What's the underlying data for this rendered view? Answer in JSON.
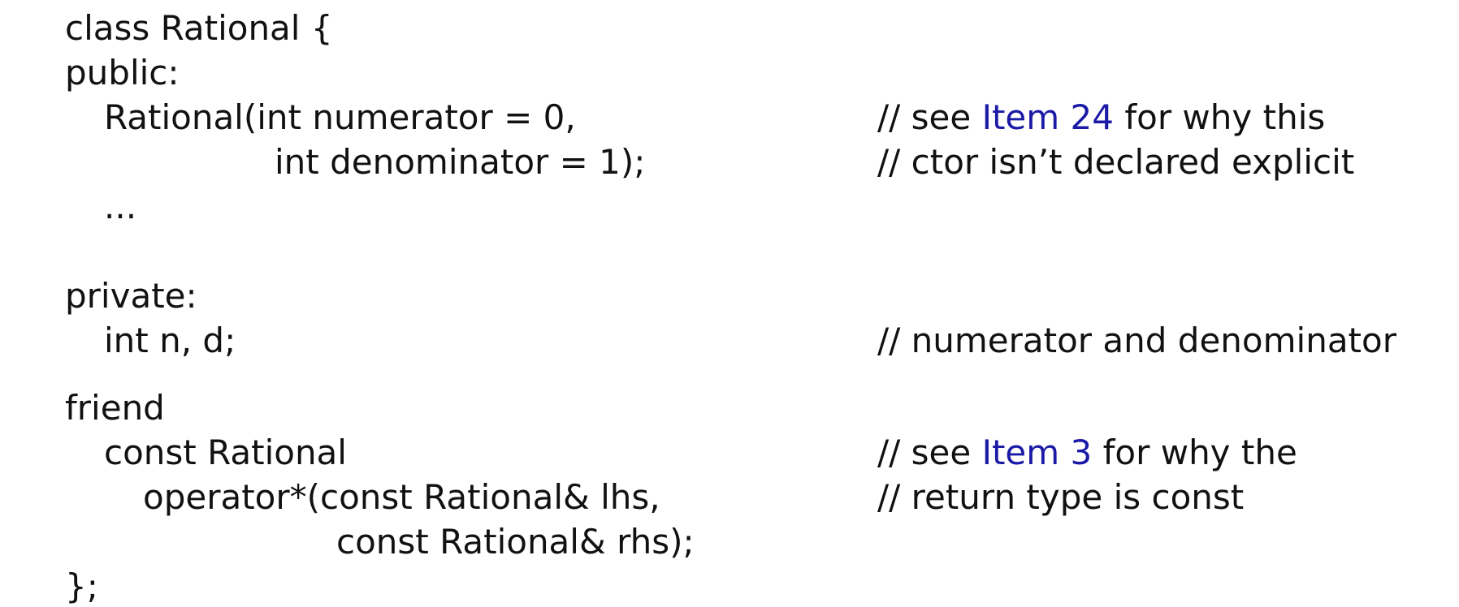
{
  "code": {
    "line1": "class Rational {",
    "line2": "public:",
    "line3": "Rational(int numerator = 0,",
    "line4": "int denominator = 1);",
    "line5": "...",
    "line6": "private:",
    "line7": "int n, d;",
    "line8": "friend",
    "line9": "const Rational",
    "line10": "operator*(const Rational& lhs,",
    "line11": "const Rational& rhs);",
    "line12": "};"
  },
  "comments": {
    "c1_prefix": "// see ",
    "c1_link": "Item 24",
    "c1_suffix": " for why this",
    "c2": "// ctor isn’t declared explicit",
    "c3": "// numerator and denominator",
    "c4_prefix": "// see ",
    "c4_link": "Item 3",
    "c4_suffix": " for why the",
    "c5": "// return type is const"
  },
  "colors": {
    "text": "#111111",
    "link": "#1a1aa6"
  }
}
